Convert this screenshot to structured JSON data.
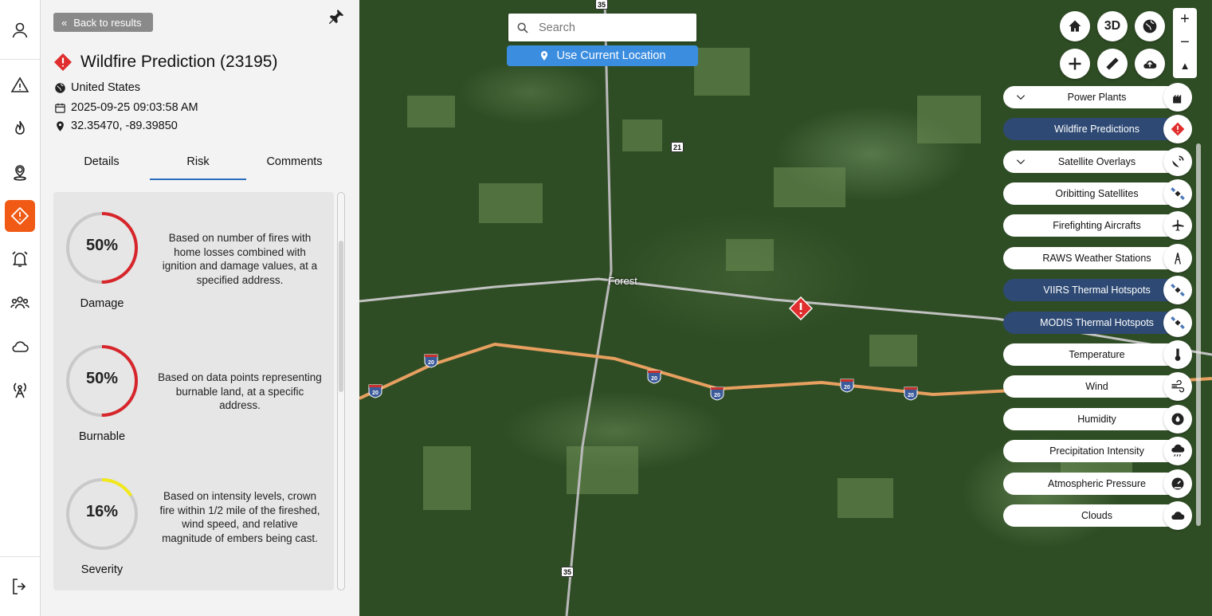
{
  "rail": {
    "items": [
      "user-icon",
      "warning-icon",
      "fire-icon",
      "location-pin-icon",
      "wildfire-prediction-icon",
      "alarm-bell-icon",
      "people-icon",
      "cloud-icon",
      "tower-icon",
      "logout-icon"
    ],
    "active_color": "#f05a14"
  },
  "panel": {
    "back_label": "Back to results",
    "title": "Wildfire Prediction (23195)",
    "country": "United States",
    "datetime": "2025-09-25 09:03:58 AM",
    "coords": "32.35470, -89.39850",
    "tabs": [
      "Details",
      "Risk",
      "Comments"
    ],
    "active_tab": "Risk",
    "risks": [
      {
        "pct": "50%",
        "value": 50,
        "color": "#d7262b",
        "label": "Damage",
        "desc": "Based on number of fires with home losses combined with ignition and damage values, at a specified address."
      },
      {
        "pct": "50%",
        "value": 50,
        "color": "#d7262b",
        "label": "Burnable",
        "desc": "Based on data points representing burnable land, at a specific address."
      },
      {
        "pct": "16%",
        "value": 16,
        "color": "#f2e81a",
        "label": "Severity",
        "desc": "Based on intensity levels, crown fire within 1/2 mile of the fireshed, wind speed, and relative magnitude of embers being cast."
      }
    ]
  },
  "map": {
    "search_placeholder": "Search",
    "use_location_label": "Use Current Location",
    "place_label": "Forest",
    "route_labels": [
      "35",
      "21",
      "35"
    ],
    "interstate_label": "20",
    "tools": [
      "home-icon",
      "3D",
      "globe-icon",
      "plus-icon",
      "ruler-icon",
      "cloud-upload-icon"
    ],
    "tool_3d": "3D",
    "zoom_in": "+",
    "zoom_out": "−",
    "layers": [
      {
        "label": "Power Plants",
        "on": false,
        "chevron": true,
        "icon": "power-plant-icon"
      },
      {
        "label": "Wildfire Predictions",
        "on": true,
        "chevron": false,
        "icon": "wildfire-prediction-icon"
      },
      {
        "label": "Satellite Overlays",
        "on": false,
        "chevron": true,
        "icon": "satellite-dish-icon"
      },
      {
        "label": "Oribitting Satellites",
        "on": false,
        "chevron": false,
        "icon": "satellite-icon"
      },
      {
        "label": "Firefighting Aircrafts",
        "on": false,
        "chevron": false,
        "icon": "airplane-icon"
      },
      {
        "label": "RAWS Weather Stations",
        "on": false,
        "chevron": false,
        "icon": "weather-station-icon"
      },
      {
        "label": "VIIRS Thermal Hotspots",
        "on": true,
        "chevron": false,
        "icon": "satellite-icon"
      },
      {
        "label": "MODIS Thermal Hotspots",
        "on": true,
        "chevron": false,
        "icon": "satellite-icon"
      },
      {
        "label": "Temperature",
        "on": false,
        "chevron": false,
        "icon": "thermometer-icon"
      },
      {
        "label": "Wind",
        "on": false,
        "chevron": false,
        "icon": "wind-icon"
      },
      {
        "label": "Humidity",
        "on": false,
        "chevron": false,
        "icon": "humidity-icon"
      },
      {
        "label": "Precipitation Intensity",
        "on": false,
        "chevron": false,
        "icon": "rain-cloud-icon"
      },
      {
        "label": "Atmospheric Pressure",
        "on": false,
        "chevron": false,
        "icon": "gauge-icon"
      },
      {
        "label": "Clouds",
        "on": false,
        "chevron": false,
        "icon": "cloud-icon"
      }
    ]
  }
}
